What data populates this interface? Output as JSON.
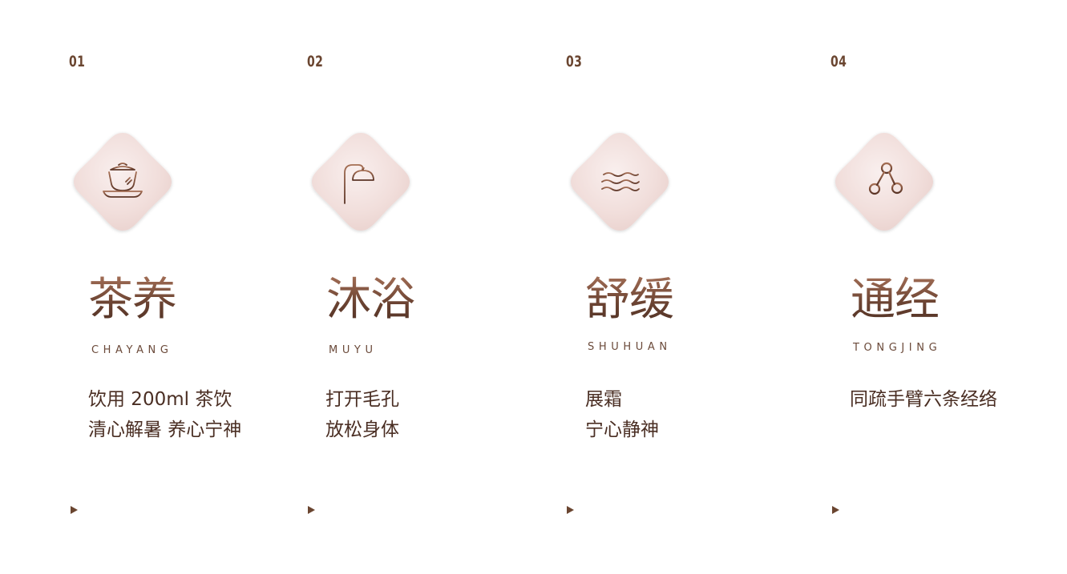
{
  "steps": [
    {
      "number": "01",
      "title": "茶养",
      "pinyin": "CHAYANG",
      "lines": [
        "饮用 200ml 茶饮",
        "清心解暑 养心宁神"
      ],
      "icon": "tea-cup-icon"
    },
    {
      "number": "02",
      "title": "沐浴",
      "pinyin": "MUYU",
      "lines": [
        "打开毛孔",
        "放松身体"
      ],
      "icon": "shower-icon"
    },
    {
      "number": "03",
      "title": "舒缓",
      "pinyin": "SHUHUAN",
      "lines": [
        "展霜",
        "宁心静神"
      ],
      "icon": "waves-icon"
    },
    {
      "number": "04",
      "title": "通经",
      "pinyin": "TONGJING",
      "lines": [
        "同疏手臂六条经络",
        ""
      ],
      "icon": "meridian-nodes-icon"
    }
  ],
  "colors": {
    "accent": "#6a4530",
    "text": "#4a2e23",
    "tile": "#f1dedb"
  }
}
